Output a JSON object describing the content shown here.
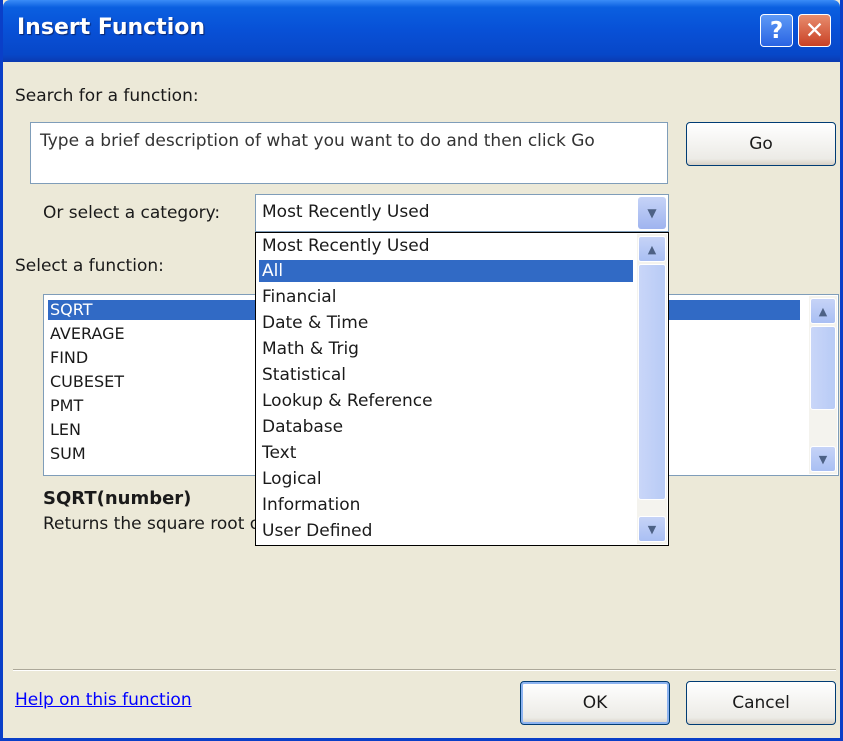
{
  "window": {
    "title": "Insert Function",
    "help_button": "?",
    "close_button": "✕"
  },
  "search": {
    "label": "Search for a function:",
    "value": "Type a brief description of what you want to do and then click Go",
    "go_button": "Go"
  },
  "category": {
    "label": "Or select a category:",
    "selected": "Most Recently Used",
    "options": [
      "Most Recently Used",
      "All",
      "Financial",
      "Date & Time",
      "Math & Trig",
      "Statistical",
      "Lookup & Reference",
      "Database",
      "Text",
      "Logical",
      "Information",
      "User Defined"
    ],
    "highlighted_option": "All"
  },
  "functions": {
    "label": "Select a function:",
    "items": [
      "SQRT",
      "AVERAGE",
      "FIND",
      "CUBESET",
      "PMT",
      "LEN",
      "SUM"
    ],
    "selected": "SQRT"
  },
  "details": {
    "signature": "SQRT(number)",
    "description": "Returns the square root of a number."
  },
  "footer": {
    "help_link": "Help on this function",
    "ok_button": "OK",
    "cancel_button": "Cancel"
  },
  "icons": {
    "scroll_up": "up-arrow-icon",
    "scroll_down": "down-arrow-icon",
    "combo_arrow": "chevron-down-icon"
  },
  "colors": {
    "titlebar": "#0850d6",
    "dialog_bg": "#ece9d8",
    "selection": "#316ac5",
    "link": "#0000ff"
  }
}
